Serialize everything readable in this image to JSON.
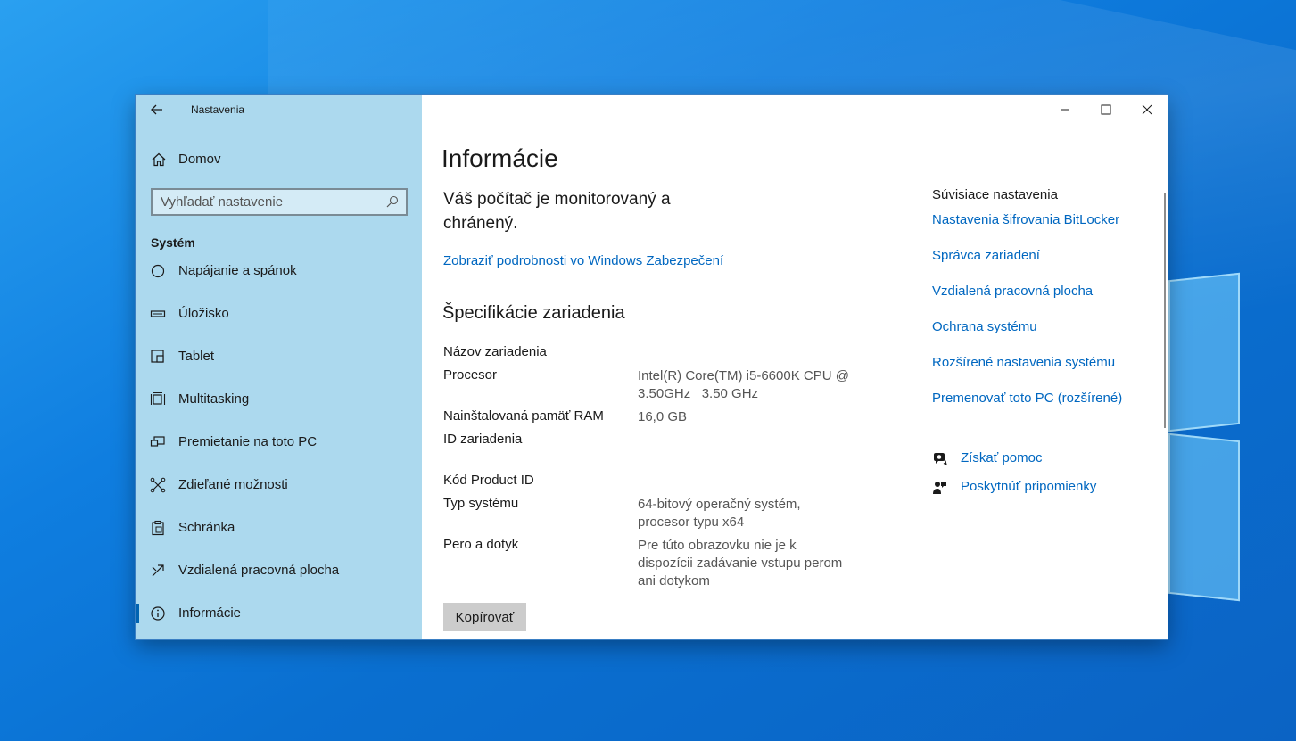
{
  "window": {
    "app_title": "Nastavenia"
  },
  "sidebar": {
    "home_label": "Domov",
    "search_placeholder": "Vyhľadať nastavenie",
    "section_title": "Systém",
    "items": [
      {
        "label": "Napájanie a spánok",
        "icon": "power-icon"
      },
      {
        "label": "Úložisko",
        "icon": "storage-icon"
      },
      {
        "label": "Tablet",
        "icon": "tablet-icon"
      },
      {
        "label": "Multitasking",
        "icon": "multitasking-icon"
      },
      {
        "label": "Premietanie na toto PC",
        "icon": "projecting-icon"
      },
      {
        "label": "Zdieľané možnosti",
        "icon": "shared-experiences-icon"
      },
      {
        "label": "Schránka",
        "icon": "clipboard-icon"
      },
      {
        "label": "Vzdialená pracovná plocha",
        "icon": "remote-desktop-icon"
      },
      {
        "label": "Informácie",
        "icon": "info-icon",
        "active": true
      }
    ]
  },
  "main": {
    "title": "Informácie",
    "status_text": "Váš počítač je monitorovaný a chránený.",
    "security_link": "Zobraziť podrobnosti vo Windows Zabezpečení",
    "spec_title": "Špecifikácie zariadenia",
    "specs": [
      {
        "key": "Názov zariadenia",
        "value": ""
      },
      {
        "key": "Procesor",
        "value": "Intel(R) Core(TM) i5-6600K CPU @ 3.50GHz   3.50 GHz"
      },
      {
        "key": "Nainštalovaná pamäť RAM",
        "value": "16,0 GB"
      },
      {
        "key": "ID zariadenia",
        "value": ""
      },
      {
        "key": "Kód Product ID",
        "value": ""
      },
      {
        "key": "Typ systému",
        "value": "64-bitový operačný systém, procesor typu x64"
      },
      {
        "key": "Pero a dotyk",
        "value": "Pre túto obrazovku nie je k dispozícii zadávanie vstupu perom ani dotykom"
      }
    ],
    "copy_button": "Kopírovať"
  },
  "related": {
    "title": "Súvisiace nastavenia",
    "links": [
      "Nastavenia šifrovania BitLocker",
      "Správca zariadení",
      "Vzdialená pracovná plocha",
      "Ochrana systému",
      "Rozšírené nastavenia systému",
      "Premenovať toto PC (rozšírené)"
    ],
    "help": [
      {
        "label": "Získať pomoc",
        "icon": "help-chat-icon"
      },
      {
        "label": "Poskytnúť pripomienky",
        "icon": "feedback-icon"
      }
    ]
  },
  "colors": {
    "sidebar_bg": "#acd9ee",
    "link": "#0067c0",
    "accent": "#0063b1"
  }
}
